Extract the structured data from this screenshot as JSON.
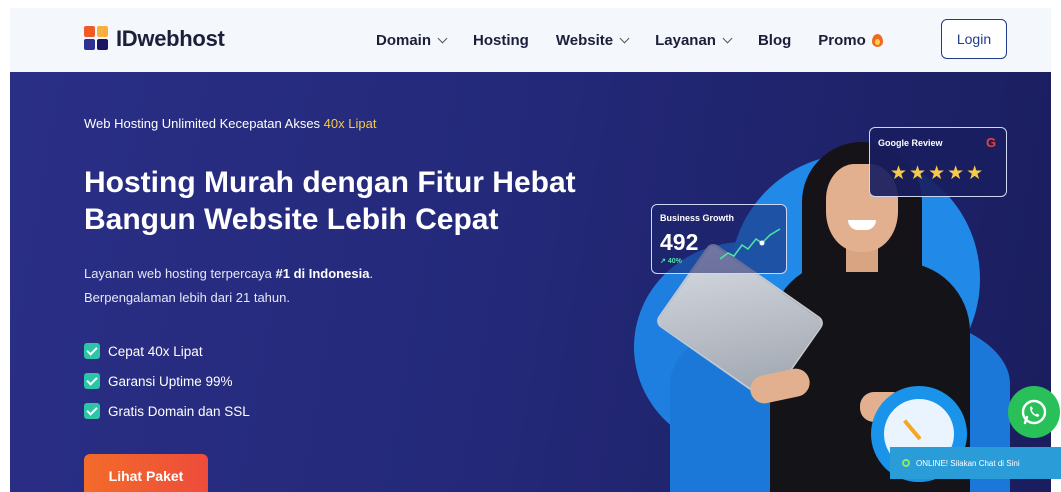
{
  "brand": {
    "name": "IDwebhost",
    "colors": {
      "orange": "#f05a28",
      "yellow": "#fbb03b",
      "navy": "#2e3192"
    }
  },
  "nav": {
    "items": [
      {
        "label": "Domain",
        "dropdown": true
      },
      {
        "label": "Hosting",
        "dropdown": false
      },
      {
        "label": "Website",
        "dropdown": true
      },
      {
        "label": "Layanan",
        "dropdown": true
      },
      {
        "label": "Blog",
        "dropdown": false
      },
      {
        "label": "Promo",
        "dropdown": false,
        "icon": "flame-icon"
      }
    ],
    "login_label": "Login"
  },
  "hero": {
    "tagline_prefix": "Web Hosting Unlimited Kecepatan Akses ",
    "tagline_highlight": "40x Lipat",
    "headline_line1": "Hosting Murah dengan Fitur Hebat",
    "headline_line2": "Bangun Website Lebih Cepat",
    "desc_prefix": "Layanan web hosting terpercaya ",
    "desc_bold": "#1 di Indonesia",
    "desc_suffix": ".",
    "desc_line2": "Berpengalaman lebih dari 21 tahun.",
    "features": [
      "Cepat 40x Lipat",
      "Garansi Uptime 99%",
      "Gratis Domain dan SSL"
    ],
    "cta_label": "Lihat Paket",
    "colors": {
      "background": "#24297a",
      "highlight": "#f7c948",
      "cta": "#f36b2a",
      "check": "#2ec4a6"
    }
  },
  "growth_card": {
    "title": "Business Growth",
    "value": "492",
    "change": "40%"
  },
  "review_card": {
    "title": "Google Review",
    "rating": 5,
    "stars": "★★★★★",
    "icon": "google-icon"
  },
  "chat": {
    "text": "ONLINE! Silakan Chat di Sini",
    "whatsapp_icon": "whatsapp-icon",
    "colors": {
      "whatsapp": "#29c05a",
      "bar": "#2a9cd8"
    }
  }
}
